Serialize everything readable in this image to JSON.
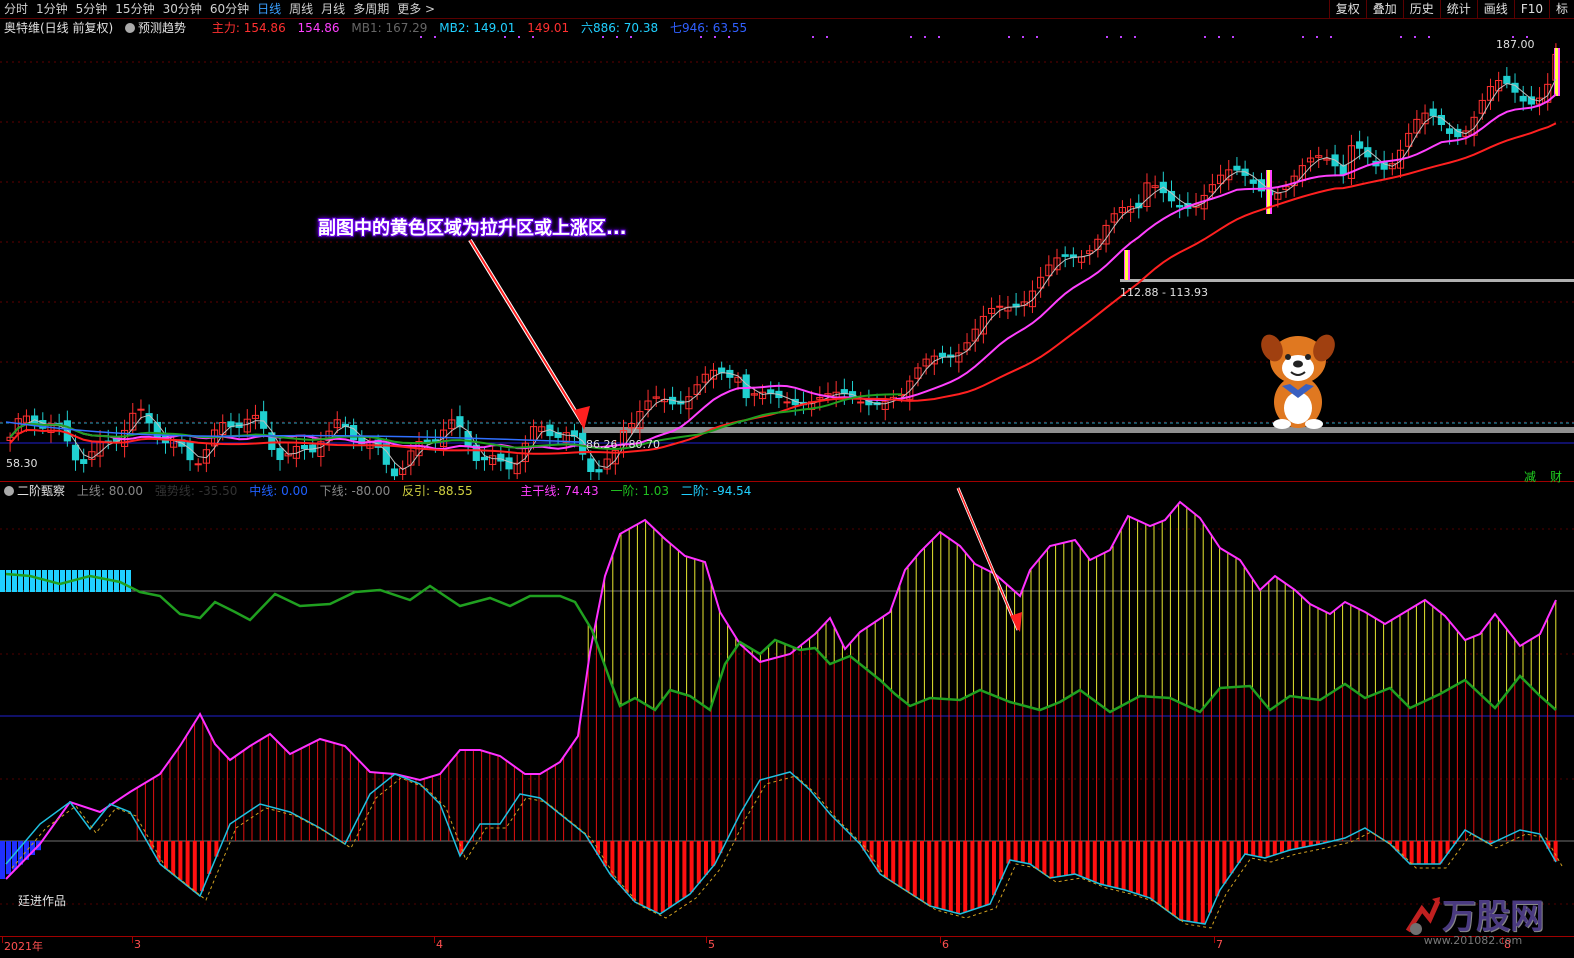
{
  "topbar": {
    "tabs": [
      "分时",
      "1分钟",
      "5分钟",
      "15分钟",
      "30分钟",
      "60分钟",
      "日线",
      "周线",
      "月线",
      "多周期",
      "更多 >"
    ],
    "active_tab": "日线",
    "right_buttons": [
      "复权",
      "叠加",
      "历史",
      "统计",
      "画线",
      "F10",
      "标"
    ]
  },
  "main_legend": {
    "title": "奥特维(日线 前复权)",
    "forecast": "预测趋势",
    "zhuli": "主力: 154.86",
    "zhuli2": "154.86",
    "mb1": "MB1: 167.29",
    "mb2": "MB2: 149.01",
    "mb2b": "149.01",
    "liu": "六886: 70.38",
    "qi": "七946: 63.55"
  },
  "price_tags": {
    "high": "187.00",
    "mid": "112.88 - 113.93",
    "low_range": "86.26 - 80.70",
    "min": "58.30"
  },
  "annotation": "副图中的黄色区域为拉升区或上涨区...",
  "sub_legend": {
    "name": "二阶甄察",
    "shang": "上线: 80.00",
    "hidden": "强势线: -35.50",
    "zhong": "中线: 0.00",
    "xia": "下线: -80.00",
    "fan": "反引: -88.55",
    "zhugan": "主干线: 74.43",
    "yijie": "一阶: 1.03",
    "erjie": "二阶: -94.54"
  },
  "sub_right": [
    "减",
    "财"
  ],
  "credit": "廷进作品",
  "date_axis": [
    "2021年",
    "3",
    "4",
    "5",
    "6",
    "7",
    "8"
  ],
  "watermark": {
    "brand": "万股网",
    "url": "www.201082.com"
  },
  "colors": {
    "up": "#ff3030",
    "down": "#20d0d0",
    "ma1": "#ff40ff",
    "ma2": "#ff2020",
    "ma3": "#20a020",
    "yellow": "#e8e830",
    "magenta": "#ff30ff",
    "green": "#20a020",
    "blue": "#2020ff"
  }
}
